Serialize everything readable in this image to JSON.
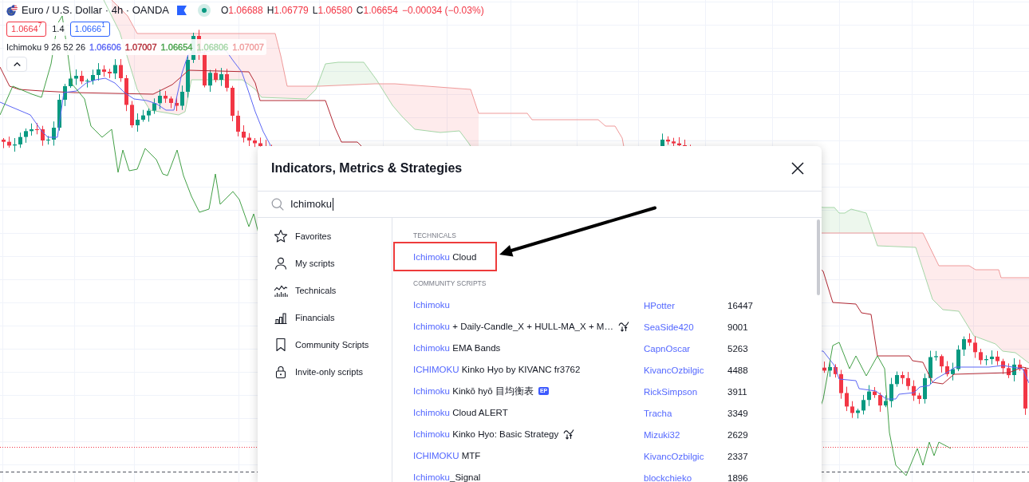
{
  "symbol_legend": {
    "title": "Euro / U.S. Dollar · 4h · OANDA",
    "market_open": true,
    "ohlc": [
      {
        "label": "O",
        "value": "1.06688"
      },
      {
        "label": "H",
        "value": "1.06779"
      },
      {
        "label": "L",
        "value": "1.06580"
      },
      {
        "label": "C",
        "value": "1.06654"
      }
    ],
    "change": "−0.00034 (−0.03%)"
  },
  "quote": {
    "sell": "1.0664$^{7}$",
    "spread": "1.4",
    "buy": "1.0666$^{1}$"
  },
  "indicator_legend": {
    "name": "Ichimoku 9 26 52 26",
    "values": [
      {
        "value": "1.06606",
        "color": "#5b66f5"
      },
      {
        "value": "1.07007",
        "color": "#b22833"
      },
      {
        "value": "1.06654",
        "color": "#43a047"
      },
      {
        "value": "1.06806",
        "color": "#a5d6a7"
      },
      {
        "value": "1.07007",
        "color": "#ef9a9a"
      }
    ]
  },
  "dialog": {
    "title": "Indicators, Metrics & Strategies",
    "search": {
      "value": "Ichimoku"
    },
    "categories": [
      {
        "label": "Favorites"
      },
      {
        "label": "My scripts"
      },
      {
        "label": "Technicals"
      },
      {
        "label": "Financials"
      },
      {
        "label": "Community Scripts"
      },
      {
        "label": "Invite-only scripts"
      }
    ],
    "sections": [
      {
        "heading": "TECHNICALS",
        "items": [
          {
            "match": "Ichimoku",
            "rest": " Cloud",
            "strategy": false
          }
        ]
      },
      {
        "heading": "COMMUNITY SCRIPTS",
        "items": [
          {
            "match": "Ichimoku",
            "strategy": false,
            "author": "HPotter",
            "count": "16447"
          },
          {
            "match": "Ichimoku",
            "rest": " + Daily-Candle_X + HULL-MA_X + M…",
            "strategy": true,
            "author": "SeaSide420",
            "count": "9001"
          },
          {
            "match": "Ichimoku",
            "rest": " EMA Bands",
            "strategy": false,
            "author": "CapnOscar",
            "count": "5263"
          },
          {
            "match": "ICHIMOKU",
            "rest": " Kinko Hyo by KIVANC fr3762",
            "strategy": false,
            "author": "KivancOzbilgic",
            "count": "4488"
          },
          {
            "match": "Ichimoku",
            "rest": " Kinkō hyō 目均衡表",
            "badge": "EP",
            "strategy": false,
            "author": "RickSimpson",
            "count": "3911"
          },
          {
            "match": "Ichimoku",
            "rest": " Cloud ALERT",
            "strategy": false,
            "author": "Tracha",
            "count": "3349"
          },
          {
            "match": "Ichimoku",
            "rest": " Kinko Hyo: Basic Strategy",
            "strategy": true,
            "author": "Mizuki32",
            "count": "2629"
          },
          {
            "match": "ICHIMOKU",
            "rest": " MTF",
            "strategy": false,
            "author": "KivancOzbilgic",
            "count": "2337"
          },
          {
            "match": "Ichimoku",
            "rest": "_Signal",
            "strategy": false,
            "author": "blockchieko",
            "count": "1896"
          }
        ]
      }
    ]
  }
}
